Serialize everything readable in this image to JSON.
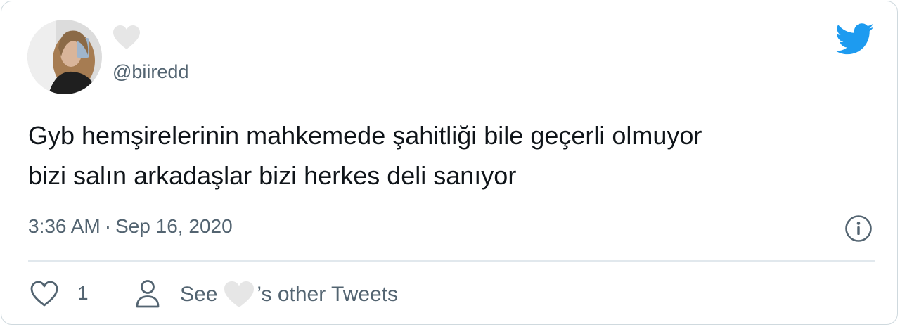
{
  "tweet": {
    "handle": "@biiredd",
    "text_lines": [
      "Gyb hemşirelerinin mahkemede şahitliği bile geçerli olmuyor",
      "bizi salın arkadaşlar bizi herkes deli sanıyor"
    ],
    "time": "3:36 AM",
    "separator": "·",
    "date": "Sep 16, 2020",
    "like_count": "1",
    "see_prefix": "See",
    "see_suffix": "’s other Tweets"
  },
  "icons": {
    "brand": "twitter-bird-icon",
    "display_name": "heart-icon",
    "info": "info-icon",
    "like": "heart-outline-icon",
    "profile": "person-icon"
  },
  "colors": {
    "brand": "#1d9bf0",
    "text": "#0f1419",
    "secondary": "#536471",
    "divider": "#e1e8ed",
    "heart_gray": "#e6e6e6"
  }
}
